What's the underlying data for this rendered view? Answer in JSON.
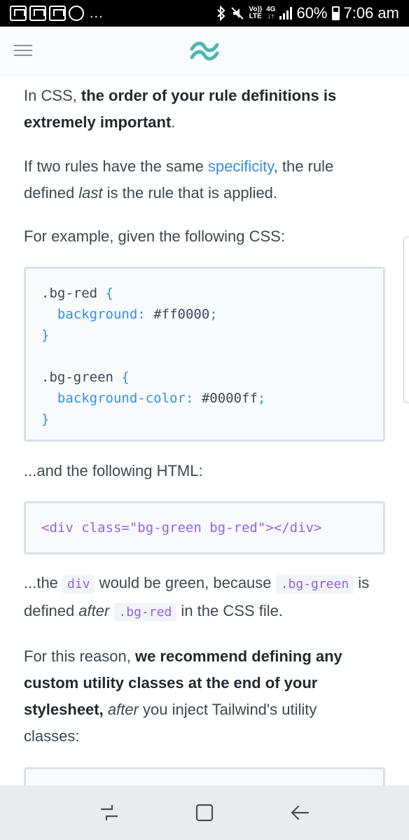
{
  "status_bar": {
    "dots": "...",
    "network": {
      "volte_top": "Vo))",
      "volte_bottom": "LTE",
      "gen": "4G"
    },
    "battery": "60%",
    "time": "7:06 am"
  },
  "header": {
    "menu_icon": "hamburger-icon",
    "logo_icon": "tailwind-logo"
  },
  "content": {
    "p1": {
      "prefix": "In CSS, ",
      "bold": "the order of your rule definitions is extremely important",
      "suffix": "."
    },
    "p2": {
      "prefix": "If two rules have the same ",
      "link": "specificity",
      "middle": ", the rule defined ",
      "italic": "last",
      "suffix": " is the rule that is applied."
    },
    "p3": "For example, given the following CSS:",
    "css_block": {
      "line1_sel": ".bg-red",
      "line2_prop": "background:",
      "line2_val": "#ff0000",
      "line4_sel": ".bg-green",
      "line5_prop": "background-color:",
      "line5_val": "#0000ff"
    },
    "p4": "...and the following HTML:",
    "html_block": {
      "open": "<div",
      "attr": " class=",
      "str": "\"bg-green bg-red\"",
      "close": "></div>"
    },
    "p5": {
      "t1": "...the ",
      "c1": "div",
      "t2": " would be green, because ",
      "c2": ".bg-green",
      "t3": " is defined ",
      "i1": "after",
      "t4": " ",
      "c3": ".bg-red",
      "t5": " in the CSS file."
    },
    "p6": {
      "prefix": "For this reason, ",
      "bold": "we recommend defining any custom utility classes at the end of your stylesheet,",
      "space": " ",
      "italic": "after",
      "suffix": " you inject Tailwind's utility classes:"
    }
  },
  "nav_bar": {
    "recent_icon": "recent-apps-icon",
    "home_icon": "home-icon",
    "back_icon": "back-icon"
  },
  "colors": {
    "link": "#3490dc",
    "code_purple": "#9561e2",
    "logo_teal": "#4fb6b2",
    "text": "#3d4852"
  }
}
